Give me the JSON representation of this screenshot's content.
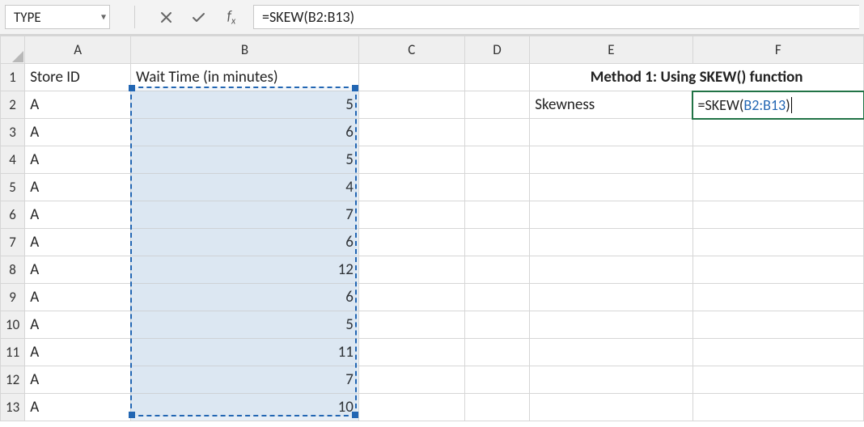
{
  "namebox": {
    "value": "TYPE"
  },
  "formula_bar": {
    "prefix": "=SKEW(",
    "ref": "B2:B13",
    "suffix": ")"
  },
  "col_heads": [
    "A",
    "B",
    "C",
    "D",
    "E",
    "F"
  ],
  "row_heads": [
    "1",
    "2",
    "3",
    "4",
    "5",
    "6",
    "7",
    "8",
    "9",
    "10",
    "11",
    "12",
    "13"
  ],
  "header_row": {
    "A": "Store ID",
    "B": "Wait Time (in minutes)",
    "E_F": "Method 1: Using SKEW() function"
  },
  "skewness_label": "Skewness",
  "edit_cell": {
    "prefix": "=SKEW(",
    "ref": "B2:B13",
    "suffix": ")"
  },
  "dataA": [
    "A",
    "A",
    "A",
    "A",
    "A",
    "A",
    "A",
    "A",
    "A",
    "A",
    "A",
    "A"
  ],
  "dataB": [
    5,
    6,
    5,
    4,
    7,
    6,
    12,
    6,
    5,
    11,
    7,
    10
  ]
}
